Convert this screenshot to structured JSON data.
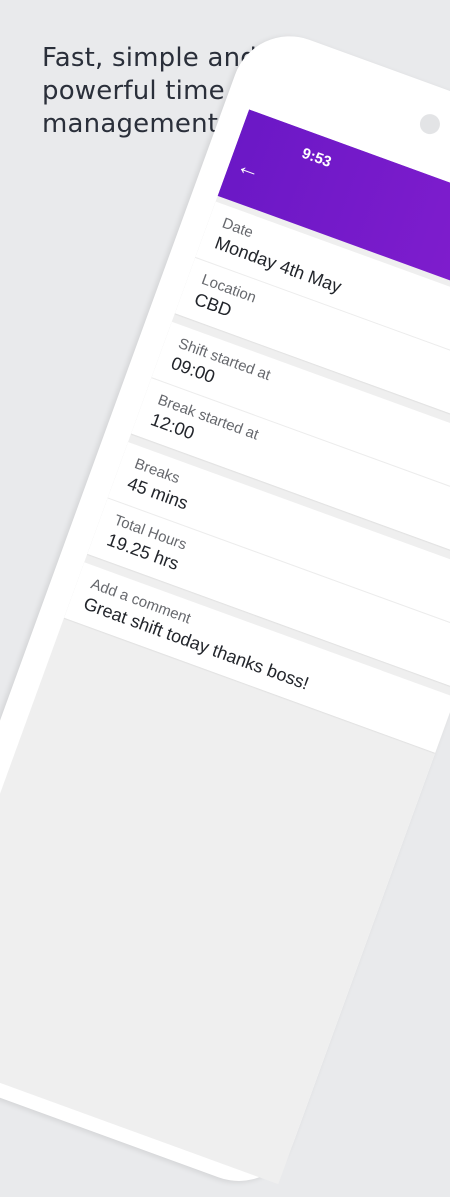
{
  "headline": {
    "line1": "Fast, simple and",
    "line2": "powerful time",
    "line3": "management"
  },
  "status_bar": {
    "time": "9:53"
  },
  "app_bar": {
    "back_icon": "arrow-left-icon",
    "accent_start": "#6b18c6",
    "accent_end": "#8a1fd1"
  },
  "fields": {
    "date": {
      "label": "Date",
      "value": "Monday 4th May"
    },
    "location": {
      "label": "Location",
      "value": "CBD"
    },
    "shift_started": {
      "label": "Shift started at",
      "value": "09:00"
    },
    "break_started": {
      "label": "Break started at",
      "value": "12:00"
    },
    "breaks": {
      "label": "Breaks",
      "value": "45 mins"
    },
    "total_hours": {
      "label": "Total Hours",
      "value": "19.25 hrs"
    },
    "comment": {
      "label": "Add a comment",
      "value": "Great shift today thanks boss!"
    }
  }
}
